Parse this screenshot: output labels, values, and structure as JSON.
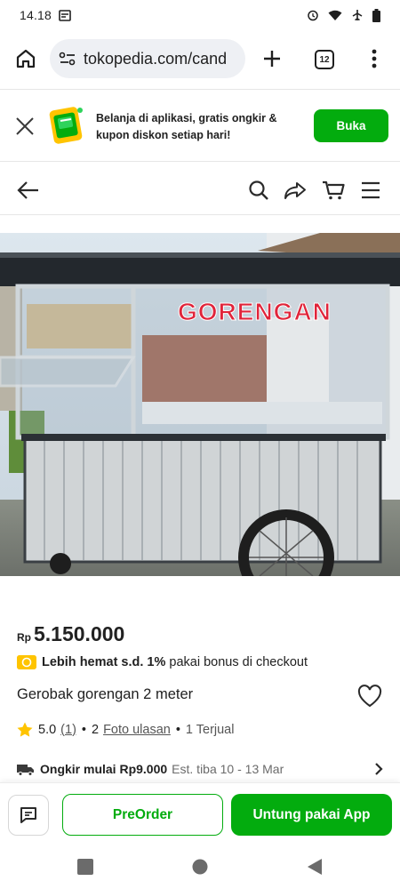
{
  "status_bar": {
    "time": "14.18"
  },
  "browser": {
    "url": "tokopedia.com/cand",
    "tab_count": "12"
  },
  "app_banner": {
    "message": "Belanja di aplikasi, gratis ongkir & kupon diskon setiap hari!",
    "open_label": "Buka"
  },
  "product": {
    "currency": "Rp",
    "price": "5.150.000",
    "image_caption": "GORENGAN",
    "promo_bold": "Lebih hemat s.d. 1%",
    "promo_rest": "pakai bonus di checkout",
    "title": "Gerobak gorengan 2 meter",
    "rating": "5.0",
    "rating_count": "(1)",
    "photo_count": "2",
    "photo_reviews_label": "Foto ulasan",
    "sold_label": "1 Terjual",
    "ongkir_label": "Ongkir mulai Rp9.000",
    "eta_label": "Est. tiba 10 - 13 Mar"
  },
  "bottom_bar": {
    "preorder_label": "PreOrder",
    "app_button_label": "Untung pakai App"
  },
  "colors": {
    "brand_green": "#03ac0e",
    "promo_yellow": "#ffc400",
    "star_yellow": "#ffc400"
  },
  "icons": [
    "home-icon",
    "site-settings-icon",
    "plus-icon",
    "tab-switcher-icon",
    "more-vert-icon",
    "close-icon",
    "gift-app-icon",
    "back-arrow-icon",
    "search-icon",
    "share-icon",
    "cart-icon",
    "menu-icon",
    "heart-icon",
    "star-icon",
    "truck-icon",
    "chevron-right-icon",
    "chat-icon"
  ]
}
